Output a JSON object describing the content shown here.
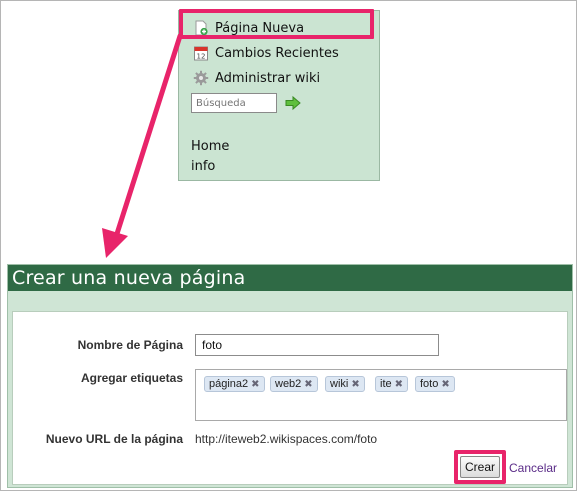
{
  "menu": {
    "items": [
      {
        "label": "Página Nueva",
        "icon": "new-page-icon"
      },
      {
        "label": "Cambios Recientes",
        "icon": "calendar-icon"
      },
      {
        "label": "Administrar wiki",
        "icon": "gear-icon"
      }
    ],
    "search_placeholder": "Búsqueda",
    "links": [
      "Home",
      "info"
    ]
  },
  "dialog": {
    "title": "Crear una nueva página",
    "name_label": "Nombre de Página",
    "name_value": "foto",
    "tags_label": "Agregar etiquetas",
    "tags": [
      "página2",
      "web2",
      "wiki",
      "ite",
      "foto"
    ],
    "url_label": "Nuevo URL de la página",
    "url_value": "http://iteweb2.wikispaces.com/foto",
    "create_label": "Crear",
    "cancel_label": "Cancelar"
  },
  "colors": {
    "highlight": "#e8246a",
    "header_bg": "#2f6a45",
    "panel_bg": "#cbe4d2"
  }
}
